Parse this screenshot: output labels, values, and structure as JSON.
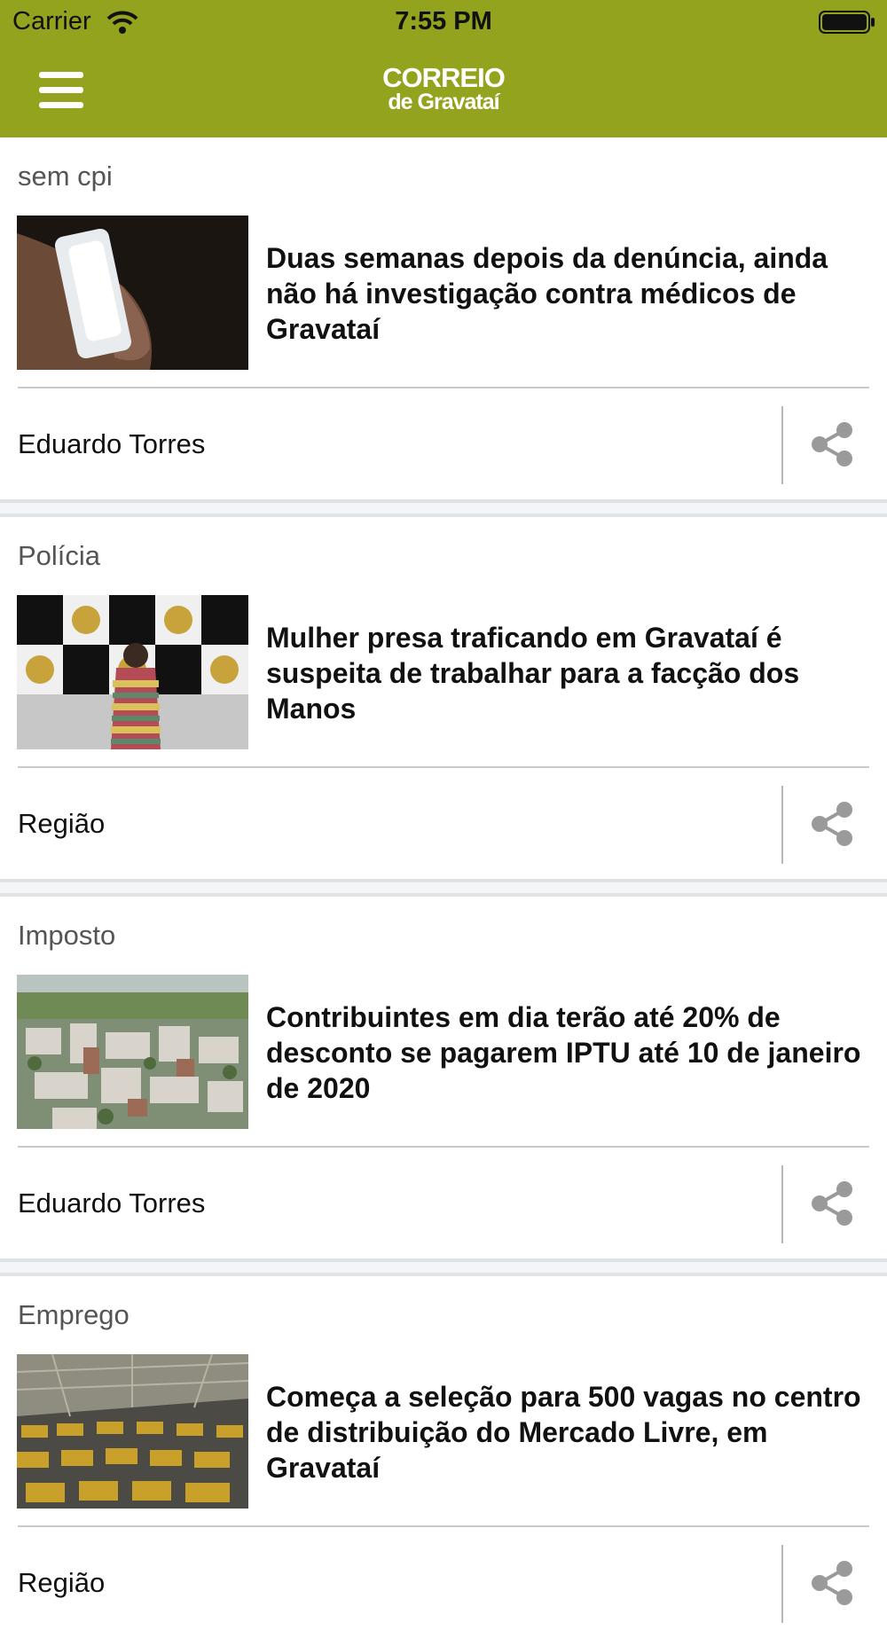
{
  "status_bar": {
    "carrier": "Carrier",
    "time": "7:55 PM"
  },
  "header": {
    "logo_line1": "CORREIO",
    "logo_line2": "de Gravataí"
  },
  "colors": {
    "brand": "#93a31e",
    "separator": "#dfe3e6"
  },
  "articles": [
    {
      "category": "sem cpi",
      "headline": "Duas semanas depois da denúncia, ainda não há investigação contra médicos de Gravataí",
      "author": "Eduardo Torres",
      "image": "bandaged-eye-photo"
    },
    {
      "category": "Polícia",
      "headline": "Mulher presa traficando em Gravataí é suspeita de trabalhar para a facção dos Manos",
      "author": "Região",
      "image": "policia-civil-backdrop-photo"
    },
    {
      "category": "Imposto",
      "headline": "Contribuintes em dia terão até 20% de desconto se pagarem IPTU até 10 de janeiro de 2020",
      "author": "Eduardo Torres",
      "image": "city-aerial-photo"
    },
    {
      "category": "Emprego",
      "headline": "Começa a seleção para 500 vagas no centro de distribuição do Mercado Livre, em Gravataí",
      "author": "Região",
      "image": "warehouse-photo"
    }
  ]
}
